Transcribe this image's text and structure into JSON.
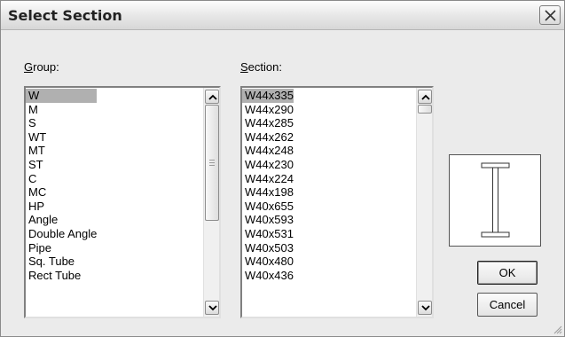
{
  "window": {
    "title": "Select Section",
    "close_icon": "close-icon"
  },
  "group": {
    "label_prefix": "",
    "label_mnemonic": "G",
    "label_rest": "roup:",
    "items": [
      "W",
      "M",
      "S",
      "WT",
      "MT",
      "ST",
      "C",
      "MC",
      "HP",
      "Angle",
      "Double Angle",
      "Pipe",
      "Sq. Tube",
      "Rect Tube"
    ],
    "selected": "W"
  },
  "section": {
    "label_mnemonic": "S",
    "label_rest": "ection:",
    "items": [
      "W44x335",
      "W44x290",
      "W44x285",
      "W44x262",
      "W44x248",
      "W44x230",
      "W44x224",
      "W44x198",
      "W40x655",
      "W40x593",
      "W40x531",
      "W40x503",
      "W40x480",
      "W40x436"
    ],
    "selected": "W44x335"
  },
  "preview": {
    "shape": "i-beam-icon"
  },
  "buttons": {
    "ok": "OK",
    "cancel": "Cancel"
  },
  "colors": {
    "selection": "#b0b0b0",
    "dialog_bg": "#ebebeb"
  }
}
